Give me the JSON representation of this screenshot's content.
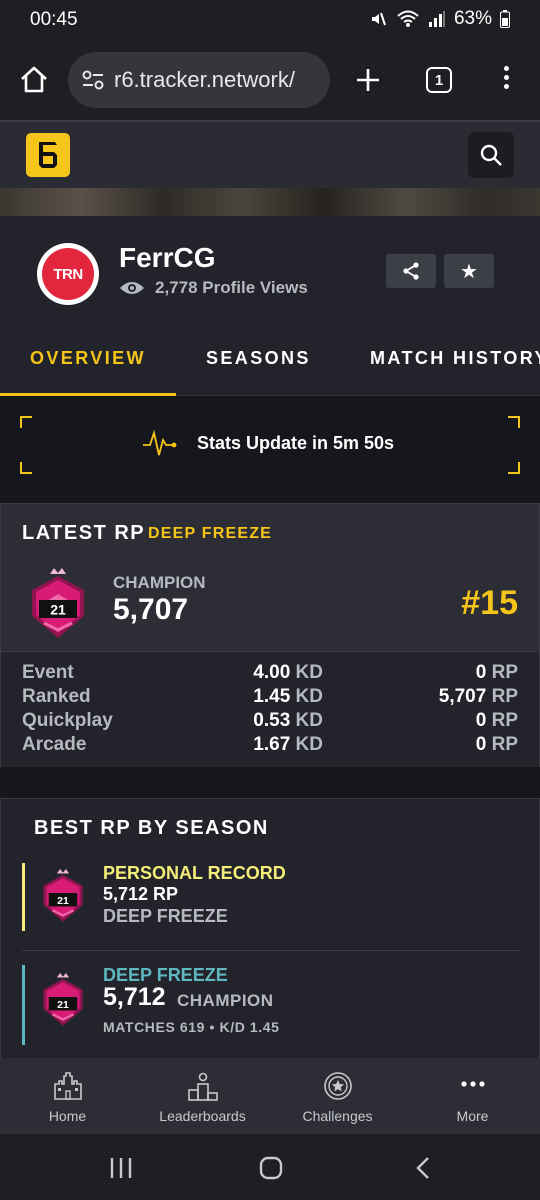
{
  "status": {
    "time": "00:45",
    "battery": "63%"
  },
  "browser": {
    "url": "r6.tracker.network/",
    "tab_count": "1"
  },
  "profile": {
    "avatar_text": "TRN",
    "username": "FerrCG",
    "views": "2,778 Profile Views"
  },
  "tabs": [
    {
      "label": "OVERVIEW",
      "active": true
    },
    {
      "label": "SEASONS",
      "active": false
    },
    {
      "label": "MATCH HISTORY",
      "active": false
    }
  ],
  "update": {
    "text": "Stats Update in 5m 50s"
  },
  "latest_rp": {
    "title": "LATEST RP",
    "season": "DEEP FREEZE",
    "badge_level": "21",
    "rank": "CHAMPION",
    "rp": "5,707",
    "position": "#15",
    "rows": [
      {
        "mode": "Event",
        "kd": "4.00",
        "kd_unit": "KD",
        "rp": "0",
        "rp_unit": "RP"
      },
      {
        "mode": "Ranked",
        "kd": "1.45",
        "kd_unit": "KD",
        "rp": "5,707",
        "rp_unit": "RP"
      },
      {
        "mode": "Quickplay",
        "kd": "0.53",
        "kd_unit": "KD",
        "rp": "0",
        "rp_unit": "RP"
      },
      {
        "mode": "Arcade",
        "kd": "1.67",
        "kd_unit": "KD",
        "rp": "0",
        "rp_unit": "RP"
      }
    ]
  },
  "best_rp": {
    "title": "BEST RP BY SEASON",
    "record": {
      "label": "PERSONAL RECORD",
      "rp": "5,712 RP",
      "season": "DEEP FREEZE",
      "badge_level": "21"
    },
    "season_entry": {
      "label": "DEEP FREEZE",
      "rp": "5,712",
      "rank": "CHAMPION",
      "meta": "MATCHES 619  •  K/D 1.45",
      "badge_level": "21"
    }
  },
  "bottom_nav": [
    {
      "label": "Home",
      "icon": "castle-icon"
    },
    {
      "label": "Leaderboards",
      "icon": "podium-icon"
    },
    {
      "label": "Challenges",
      "icon": "medal-icon"
    },
    {
      "label": "More",
      "icon": "more-dots-icon"
    }
  ],
  "colors": {
    "accent": "#f6c519",
    "record": "#f4ed7a",
    "season": "#5fb7c0",
    "rank": "#d81b74"
  }
}
